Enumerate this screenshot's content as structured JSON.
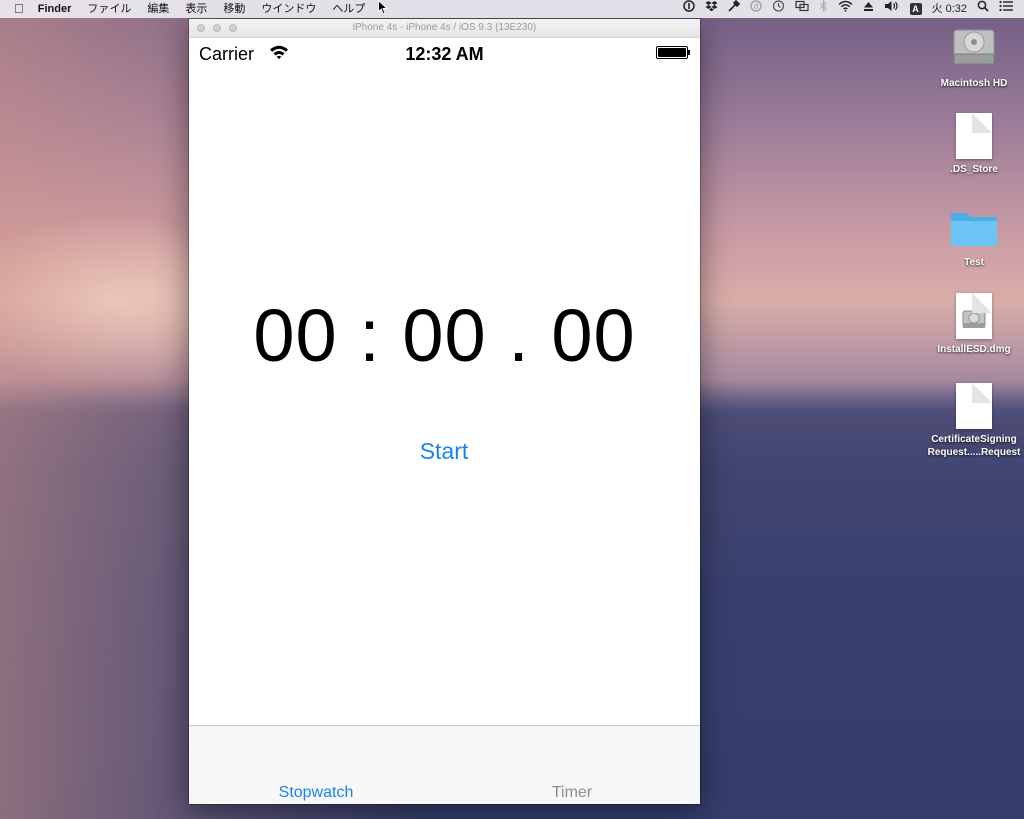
{
  "menubar": {
    "apple_glyph": "",
    "app_name": "Finder",
    "items": [
      "ファイル",
      "編集",
      "表示",
      "移動",
      "ウインドウ",
      "ヘルプ"
    ],
    "tray": {
      "ime_label": "A",
      "clock": "火 0:32"
    }
  },
  "simulator": {
    "title": "iPhone 4s - iPhone 4s / iOS 9.3 (13E230)",
    "status_bar": {
      "carrier": "Carrier",
      "time": "12:32 AM"
    },
    "stopwatch": {
      "display": "00 : 00 . 00",
      "start_label": "Start"
    },
    "tabs": [
      {
        "label": "Stopwatch",
        "selected": true
      },
      {
        "label": "Timer",
        "selected": false
      }
    ]
  },
  "desktop_icons": [
    {
      "label": "Macintosh HD",
      "icon": "hard-drive-icon"
    },
    {
      "label": ".DS_Store",
      "icon": "document-icon"
    },
    {
      "label": "Test",
      "icon": "folder-icon"
    },
    {
      "label": "InstallESD.dmg",
      "icon": "disk-image-icon"
    },
    {
      "label_line1": "CertificateSigning",
      "label_line2": "Request.....Request",
      "icon": "document-icon"
    }
  ],
  "colors": {
    "accent": "#1a82f0",
    "inactive_tab": "#8e8e8e",
    "folder": "#5cb8ef"
  }
}
